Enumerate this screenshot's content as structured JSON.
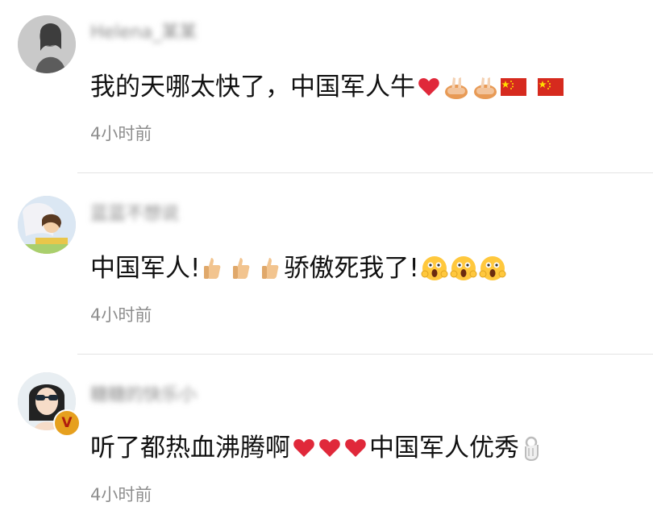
{
  "comments": [
    {
      "username": "Helena_某某",
      "text_main": "我的天哪太快了，中国军人牛",
      "text_tail": "",
      "emojis_main": [
        "red-heart",
        "praying-hands",
        "praying-hands",
        "china-flag",
        "china-flag"
      ],
      "emojis_tail": [],
      "timestamp": "4小时前",
      "verified": false
    },
    {
      "username": "蓝蓝不想说",
      "text_main": "中国军人!",
      "text_tail": "骄傲死我了!",
      "emojis_main": [
        "thumbs-up",
        "thumbs-up",
        "thumbs-up"
      ],
      "emojis_tail": [
        "scream-face",
        "scream-face",
        "scream-face"
      ],
      "timestamp": "4小时前",
      "verified": false
    },
    {
      "username": "糖糖的快乐小",
      "text_main": "听了都热血沸腾啊",
      "text_tail": "中国军人优秀",
      "emojis_main": [
        "red-heart",
        "red-heart",
        "red-heart"
      ],
      "emojis_tail": [
        "ok-hand"
      ],
      "timestamp": "4小时前",
      "verified": true,
      "badge_label": "V"
    }
  ],
  "colors": {
    "text": "#111111",
    "meta": "#8e8e8e",
    "divider": "#e4e4e4",
    "heart": "#e0283a",
    "flag": "#d62a1e",
    "badge": "#e6a01e"
  }
}
